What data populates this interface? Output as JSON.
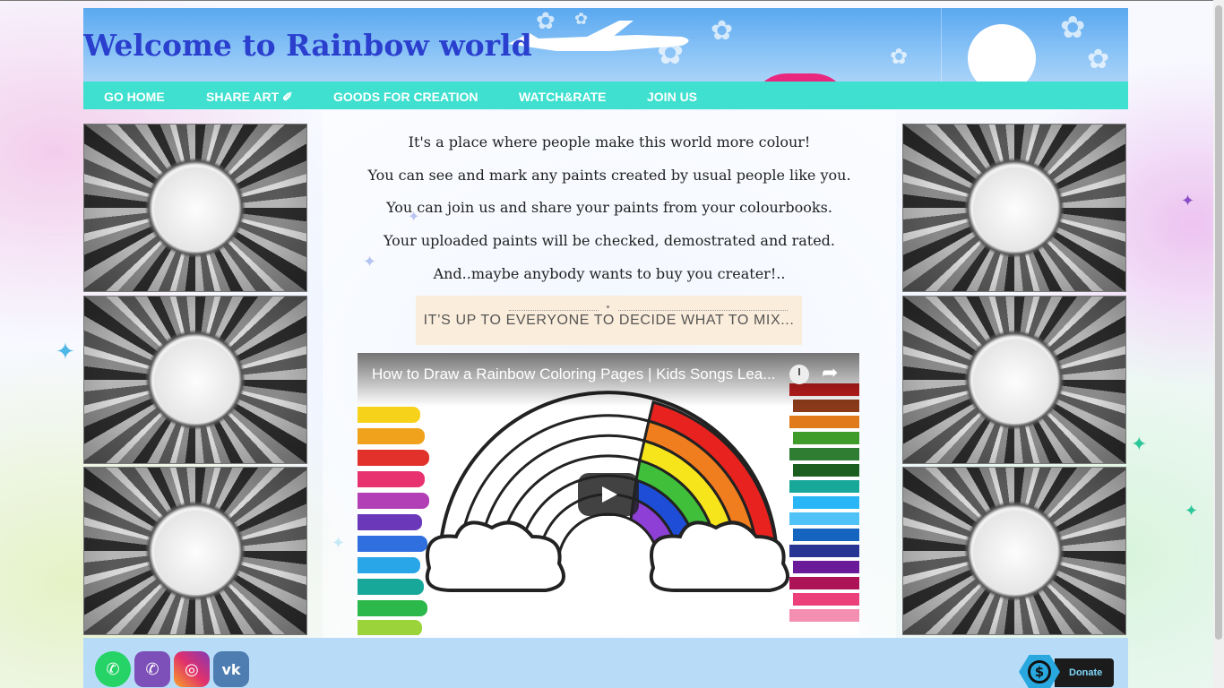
{
  "header": {
    "title": "Welcome to Rainbow world"
  },
  "nav": {
    "items": [
      {
        "label": "GO HOME"
      },
      {
        "label": "SHARE ART ✐"
      },
      {
        "label": "GOODS FOR CREATION"
      },
      {
        "label": "WATCH&RATE"
      },
      {
        "label": "JOIN US"
      }
    ]
  },
  "content": {
    "paragraphs": [
      "It's a place where people make this world more colour!",
      "You can see and mark any paints created by usual people like you.",
      "You can join us and share your paints from your colourbooks.",
      "Your uploaded paints will be checked, demostrated and rated.",
      "And..maybe anybody wants to buy you creater!.."
    ],
    "banner": "IT’S UP TO EVERYONE TO DECIDE WHAT TO MIX..."
  },
  "video": {
    "title": "How to Draw a Rainbow Coloring Pages | Kids Songs Lea...",
    "icons": [
      "clock-icon",
      "share-icon",
      "play-icon"
    ]
  },
  "footer": {
    "social": [
      {
        "name": "whatsapp",
        "glyph": "✆",
        "color": "#25d366"
      },
      {
        "name": "viber",
        "glyph": "✆",
        "color": "#7d4fb8"
      },
      {
        "name": "instagram",
        "glyph": "◎",
        "color": "#d6307c"
      },
      {
        "name": "vk",
        "glyph": "vk",
        "color": "#4e7db2"
      }
    ],
    "donate_label": "Donate",
    "donate_symbol": "$"
  },
  "colors": {
    "nav_bg": "#40e0d0",
    "title": "#2a3fce",
    "banner_bg": "#fbeddb",
    "footer_bg": "#b8dcf8"
  }
}
